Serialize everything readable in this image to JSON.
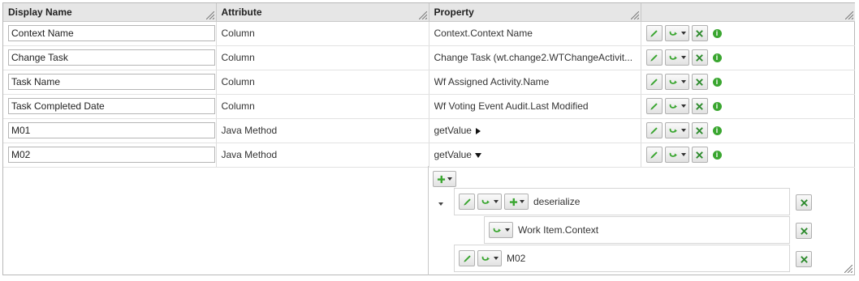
{
  "columns": {
    "display_name": "Display Name",
    "attribute": "Attribute",
    "property": "Property"
  },
  "rows": [
    {
      "display_name": "Context Name",
      "attribute": "Column",
      "property": "Context.Context Name"
    },
    {
      "display_name": "Change Task",
      "attribute": "Column",
      "property": "Change Task (wt.change2.WTChangeActivit..."
    },
    {
      "display_name": "Task Name",
      "attribute": "Column",
      "property": "Wf Assigned Activity.Name"
    },
    {
      "display_name": "Task Completed Date",
      "attribute": "Column",
      "property": "Wf Voting Event Audit.Last Modified"
    },
    {
      "display_name": "M01",
      "attribute": "Java Method",
      "property": "getValue"
    },
    {
      "display_name": "M02",
      "attribute": "Java Method",
      "property": "getValue"
    }
  ],
  "tree": {
    "root": "deserialize",
    "child_1": "Work Item.Context",
    "child_2": "M02"
  },
  "icons": {
    "edit": "pencil-icon",
    "map": "mapping-arrow-icon",
    "delete": "x-delete-icon",
    "info": "info-icon",
    "add": "plus-icon"
  },
  "colors": {
    "accent_green": "#3aa630",
    "header_bg": "#e6e6e6"
  }
}
